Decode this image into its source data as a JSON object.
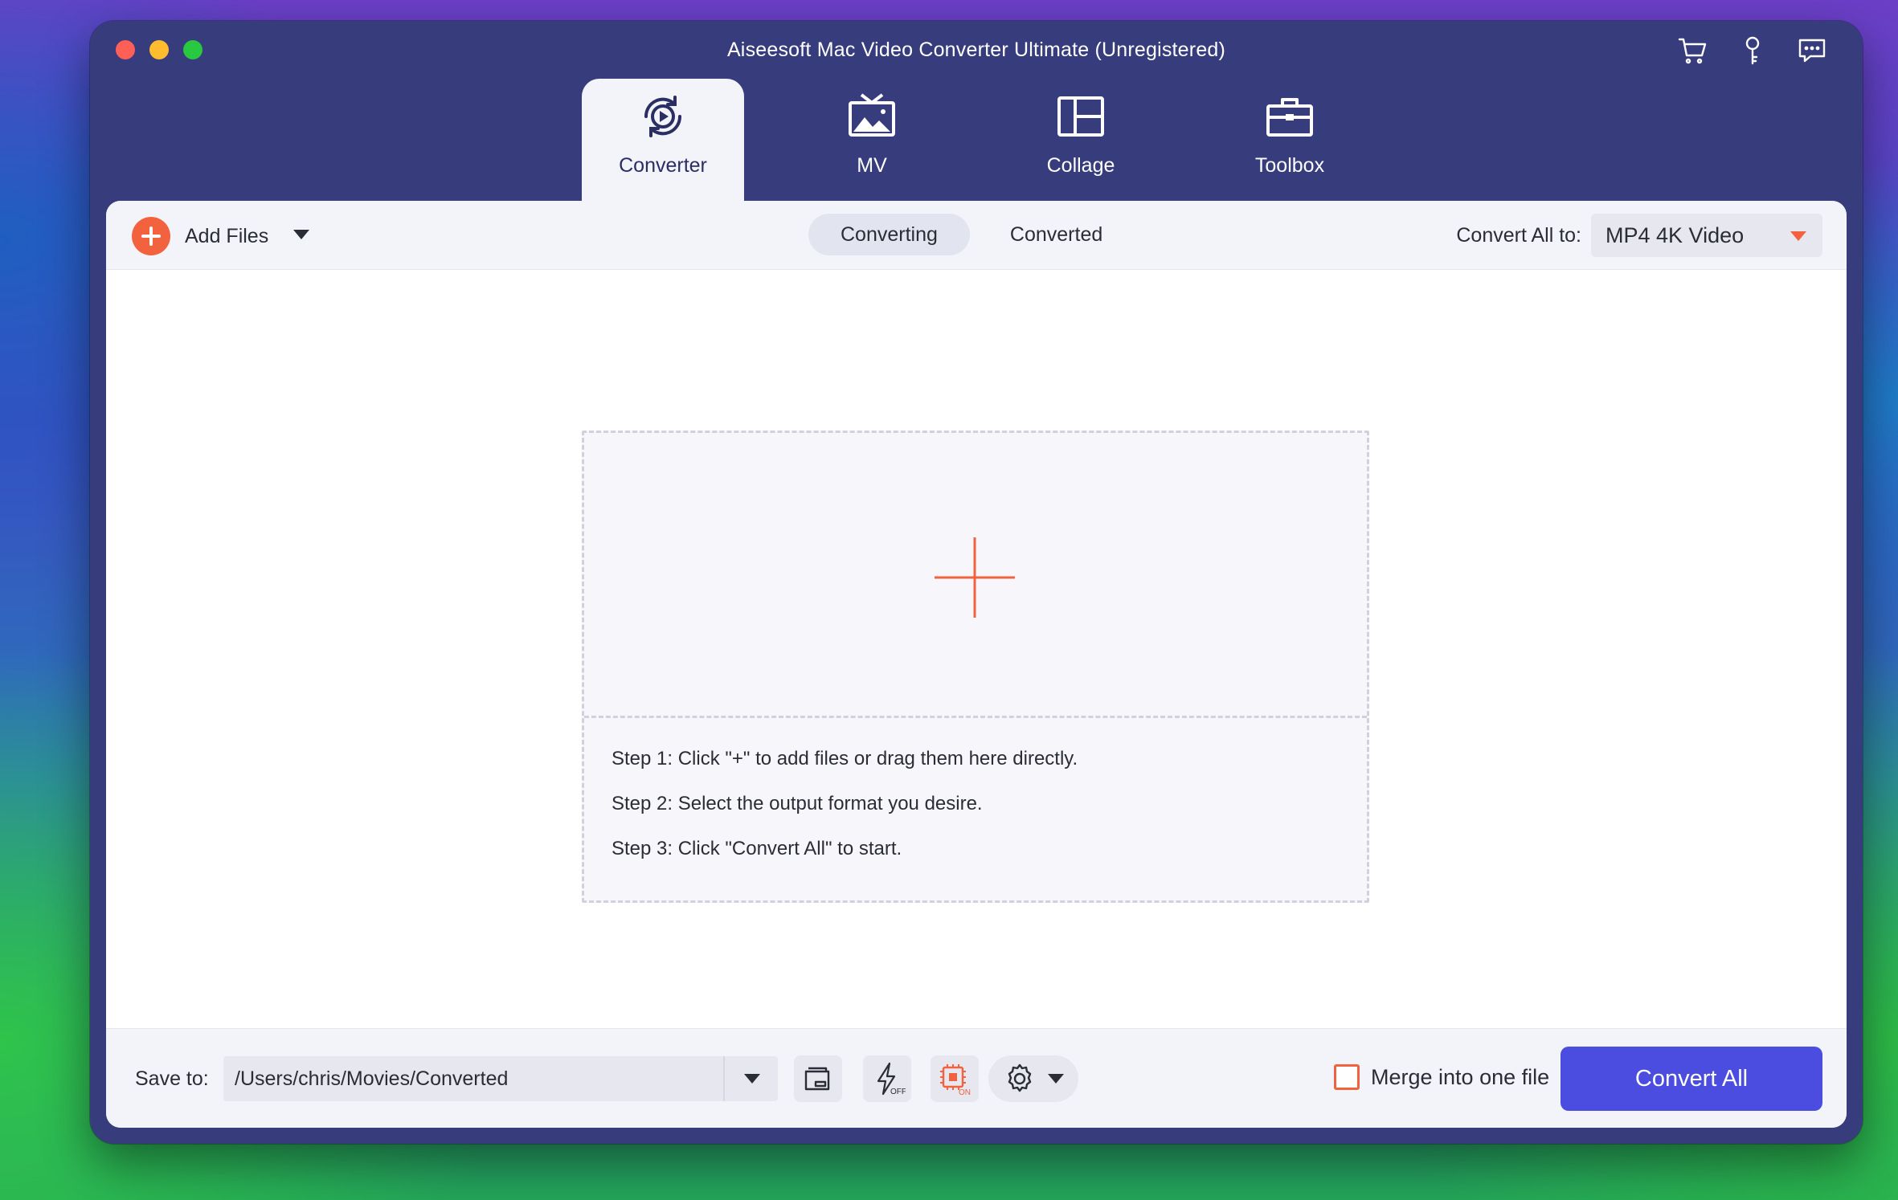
{
  "window": {
    "title": "Aiseesoft Mac Video Converter Ultimate (Unregistered)",
    "top_icons": [
      "cart-icon",
      "key-icon",
      "feedback-icon"
    ]
  },
  "tabs": [
    {
      "label": "Converter",
      "icon": "converter-icon",
      "active": true
    },
    {
      "label": "MV",
      "icon": "mv-icon",
      "active": false
    },
    {
      "label": "Collage",
      "icon": "collage-icon",
      "active": false
    },
    {
      "label": "Toolbox",
      "icon": "toolbox-icon",
      "active": false
    }
  ],
  "toolbar": {
    "add_files_label": "Add Files",
    "segments": [
      {
        "label": "Converting",
        "active": true
      },
      {
        "label": "Converted",
        "active": false
      }
    ],
    "convert_all_to_label": "Convert All to:",
    "format_value": "MP4 4K Video"
  },
  "dropzone": {
    "steps": [
      "Step 1: Click \"+\" to add files or drag them here directly.",
      "Step 2: Select the output format you desire.",
      "Step 3: Click \"Convert All\" to start."
    ]
  },
  "bottom": {
    "save_to_label": "Save to:",
    "save_path": "/Users/chris/Movies/Converted",
    "hw_accel_off_label": "OFF",
    "gpu_on_label": "ON",
    "merge_label": "Merge into one file",
    "merge_checked": false,
    "convert_all_label": "Convert All"
  },
  "colors": {
    "window_bg": "#373c7d",
    "accent_orange": "#f2623f",
    "convert_button": "#4b4de0",
    "panel_bg": "#f3f4f9"
  }
}
